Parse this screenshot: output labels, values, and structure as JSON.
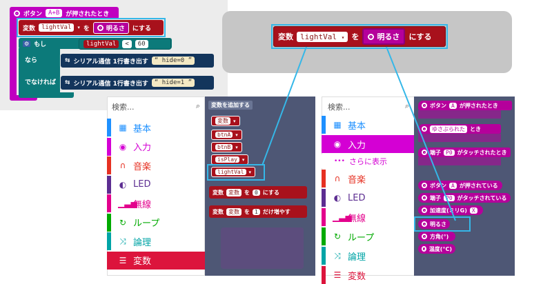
{
  "workspace": {
    "event_label": "ボタン",
    "event_button": "A+B",
    "event_suffix": "が押されたとき",
    "set_label": "変数",
    "set_var": "lightVal",
    "set_wo": "を",
    "set_value": "明るさ",
    "set_suffix": "にする",
    "if_label": "もし",
    "if_var": "lightVal",
    "if_op": "<",
    "if_num": "60",
    "then_label": "なら",
    "else_label": "でなければ",
    "serial_label": "シリアル通信 1行書き出す",
    "serial_then_text": "hide=0",
    "serial_else_text": "hide=1"
  },
  "zoom_block": {
    "label": "変数",
    "var": "lightVal",
    "wo": "を",
    "value": "明るさ",
    "suffix": "にする"
  },
  "toolbox_left": {
    "search_placeholder": "検索...",
    "items": [
      {
        "label": "基本",
        "icon": "grid-icon",
        "glyph": "▦",
        "color": "#1e90ff"
      },
      {
        "label": "入力",
        "icon": "target-icon",
        "glyph": "◉",
        "color": "#d400d4"
      },
      {
        "label": "音楽",
        "icon": "headphones-icon",
        "glyph": "∩",
        "color": "#e63022"
      },
      {
        "label": "LED",
        "icon": "toggle-icon",
        "glyph": "◐",
        "color": "#5c2d91"
      },
      {
        "label": "無線",
        "icon": "signal-icon",
        "glyph": "▁▃▅",
        "color": "#e3008c"
      },
      {
        "label": "ループ",
        "icon": "refresh-icon",
        "glyph": "↻",
        "color": "#00aa00"
      },
      {
        "label": "論理",
        "icon": "shuffle-icon",
        "glyph": "⤨",
        "color": "#00a4a6"
      },
      {
        "label": "変数",
        "icon": "list-icon",
        "glyph": "☰",
        "color": "#dc143c"
      }
    ]
  },
  "flyout_vars": {
    "add_button": "変数を追加する",
    "variables": [
      "変数",
      "btnA",
      "btnB",
      "isPlay",
      "lightVal"
    ],
    "set_block": {
      "label": "変数",
      "var": "変数",
      "wo": "を",
      "num": "0",
      "suffix": "にする"
    },
    "change_block": {
      "label": "変数",
      "var": "変数",
      "wo": "を",
      "num": "1",
      "suffix": "だけ増やす"
    }
  },
  "toolbox_right": {
    "search_placeholder": "検索...",
    "items": [
      {
        "label": "基本",
        "glyph": "▦",
        "color": "#1e90ff"
      },
      {
        "label": "入力",
        "glyph": "◉",
        "color": "#d400d4"
      },
      {
        "label": "さらに表示",
        "glyph": "•••",
        "color": "#d400d4"
      },
      {
        "label": "音楽",
        "glyph": "∩",
        "color": "#e63022"
      },
      {
        "label": "LED",
        "glyph": "◐",
        "color": "#5c2d91"
      },
      {
        "label": "無線",
        "glyph": "▁▃▅",
        "color": "#e3008c"
      },
      {
        "label": "ループ",
        "glyph": "↻",
        "color": "#00aa00"
      },
      {
        "label": "論理",
        "glyph": "⤨",
        "color": "#00a4a6"
      },
      {
        "label": "変数",
        "glyph": "☰",
        "color": "#dc143c"
      }
    ]
  },
  "flyout_input": {
    "b1": {
      "pre": "ボタン",
      "slot": "A",
      "post": "が押されたとき"
    },
    "b2": {
      "slot": "ゆさぶられた",
      "post": "とき"
    },
    "b3": {
      "pre": "端子",
      "slot": "P0",
      "post": "がタッチされたとき"
    },
    "b4": {
      "pre": "ボタン",
      "slot": "A",
      "post": "が押されている"
    },
    "b5": {
      "pre": "端子",
      "slot": "P0",
      "post": "がタッチされている"
    },
    "b6": {
      "pre": "加速度(ミリG)",
      "slot": "X"
    },
    "b7": {
      "label": "明るさ"
    },
    "b8": {
      "label": "方角(°)"
    },
    "b9": {
      "label": "温度(°C)"
    }
  },
  "colors": {
    "event": "#c000c0",
    "variable": "#a8111c",
    "logic": "#0c7a7a",
    "serial": "#13355c",
    "highlight": "#35b7e8",
    "input": "#b5009b"
  }
}
